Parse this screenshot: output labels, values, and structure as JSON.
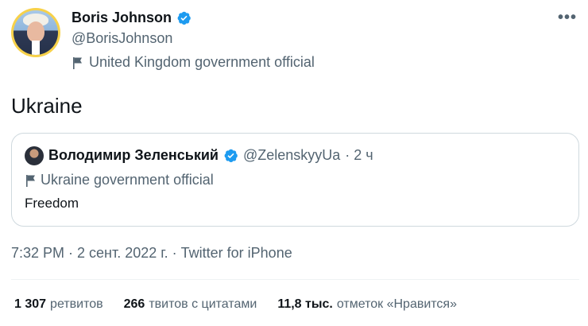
{
  "author": {
    "display_name": "Boris Johnson",
    "handle": "@BorisJohnson",
    "label": "United Kingdom government official"
  },
  "tweet": {
    "text": "Ukraine",
    "meta": "7:32 PM · 2 сент. 2022 г. · Twitter for iPhone"
  },
  "quoted": {
    "display_name": "Володимир Зеленський",
    "handle": "@ZelenskyyUa",
    "time": "· 2 ч",
    "label": "Ukraine government official",
    "text": "Freedom"
  },
  "stats": [
    {
      "value": "1 307",
      "label": "ретвитов"
    },
    {
      "value": "266",
      "label": "твитов с цитатами"
    },
    {
      "value": "11,8 тыс.",
      "label": "отметок «Нравится»"
    }
  ],
  "colors": {
    "verified": "#1d9bf0",
    "avatar_ring": "#f7d14a",
    "secondary_text": "#536471"
  },
  "icons": {
    "verified": "verified-badge-icon",
    "flag": "flag-icon",
    "more": "more-horizontal-icon"
  }
}
